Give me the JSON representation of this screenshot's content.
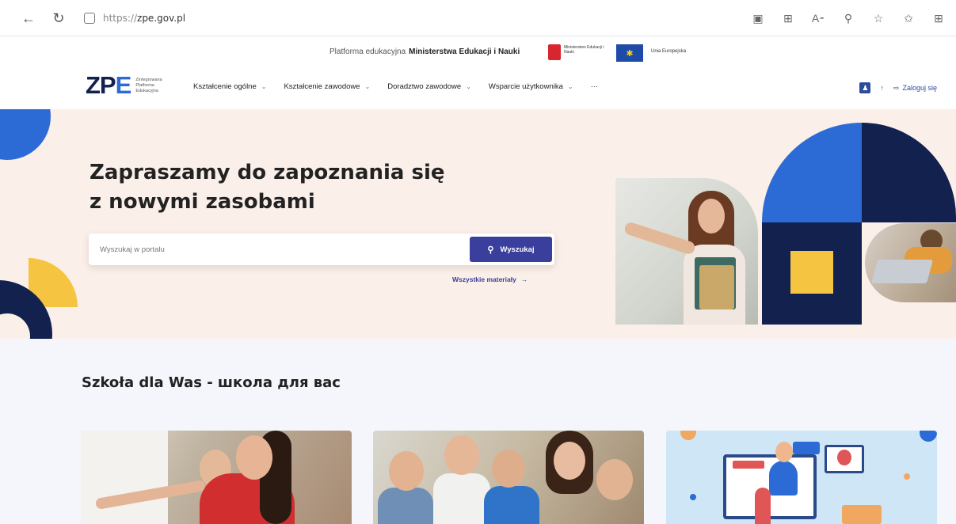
{
  "browser": {
    "url_prefix": "https://",
    "url_host": "zpe.gov.pl",
    "icons": [
      "reader-icon",
      "apps-icon",
      "read-aloud-icon",
      "zoom-icon",
      "add-favorite-icon",
      "favorites-icon",
      "collections-icon"
    ]
  },
  "header": {
    "ministry_prefix": "Platforma edukacyjna",
    "ministry_name": "Ministerstwa Edukacji i Nauki",
    "emblem_text": "Ministerstwo Edukacji i Nauki",
    "eu_text": "Unia Europejska",
    "logo_letters": "ZP",
    "logo_letter_e": "E",
    "logo_subtitle": "Zintegrowana Platforma Edukacyjna",
    "nav": [
      {
        "label": "Kształcenie ogólne"
      },
      {
        "label": "Kształcenie zawodowe"
      },
      {
        "label": "Doradztwo zawodowe"
      },
      {
        "label": "Wsparcie użytkownika"
      }
    ],
    "more": "···",
    "login": "Zaloguj się"
  },
  "hero": {
    "title_line1": "Zapraszamy do zapoznania się",
    "title_line2": "z nowymi zasobami",
    "search_placeholder": "Wyszukaj w portalu",
    "search_button": "Wyszukaj",
    "all_materials": "Wszystkie materiały"
  },
  "section": {
    "title": "Szkoła dla Was - школа для вас"
  },
  "colors": {
    "navy": "#13214f",
    "blue": "#2c6bd6",
    "yellow": "#f5c542",
    "accent": "#3a3f9d",
    "hero_bg": "#fbefe9"
  }
}
